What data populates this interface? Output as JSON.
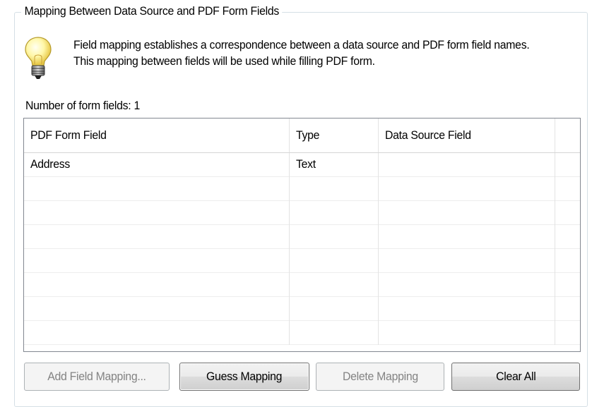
{
  "group": {
    "title": "Mapping Between Data Source and PDF Form Fields"
  },
  "info": {
    "icon": "lightbulb-icon",
    "text": "Field mapping establishes a correspondence between a data source and PDF form field names. This mapping between fields will be used while filling PDF form."
  },
  "count_label": "Number of form fields: 1",
  "grid": {
    "columns": [
      "PDF Form Field",
      "Type",
      "Data Source Field",
      ""
    ],
    "rows": [
      {
        "field": "Address",
        "type": "Text",
        "source": ""
      }
    ]
  },
  "buttons": {
    "add": {
      "label": "Add Field Mapping...",
      "enabled": false
    },
    "guess": {
      "label": "Guess Mapping",
      "enabled": true
    },
    "delete": {
      "label": "Delete Mapping",
      "enabled": false
    },
    "clear": {
      "label": "Clear All",
      "enabled": true
    }
  },
  "colors": {
    "border": "#828790",
    "frame": "#d5dfe5",
    "disabled_text": "#838383"
  }
}
